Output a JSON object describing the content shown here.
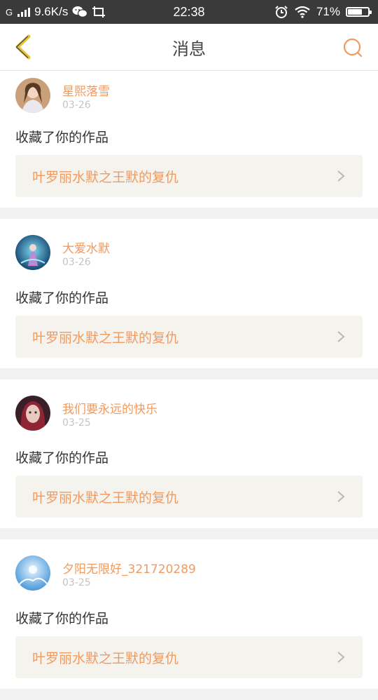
{
  "status": {
    "carrier": "G",
    "network_speed": "9.6K/s",
    "time": "22:38",
    "battery": "71%",
    "battery_level": 0.71
  },
  "header": {
    "title": "消息"
  },
  "messages": [
    {
      "user": "星熙落雪",
      "date": "03-26",
      "action": "收藏了你的作品",
      "work": "叶罗丽水默之王默的复仇"
    },
    {
      "user": "大爱水默",
      "date": "03-26",
      "action": "收藏了你的作品",
      "work": "叶罗丽水默之王默的复仇"
    },
    {
      "user": "我们要永远的快乐",
      "date": "03-25",
      "action": "收藏了你的作品",
      "work": "叶罗丽水默之王默的复仇"
    },
    {
      "user": "夕阳无限好_321720289",
      "date": "03-25",
      "action": "收藏了你的作品",
      "work": "叶罗丽水默之王默的复仇"
    }
  ],
  "colors": {
    "accent": "#f19a5f",
    "back_arrow": "#e8c339"
  }
}
